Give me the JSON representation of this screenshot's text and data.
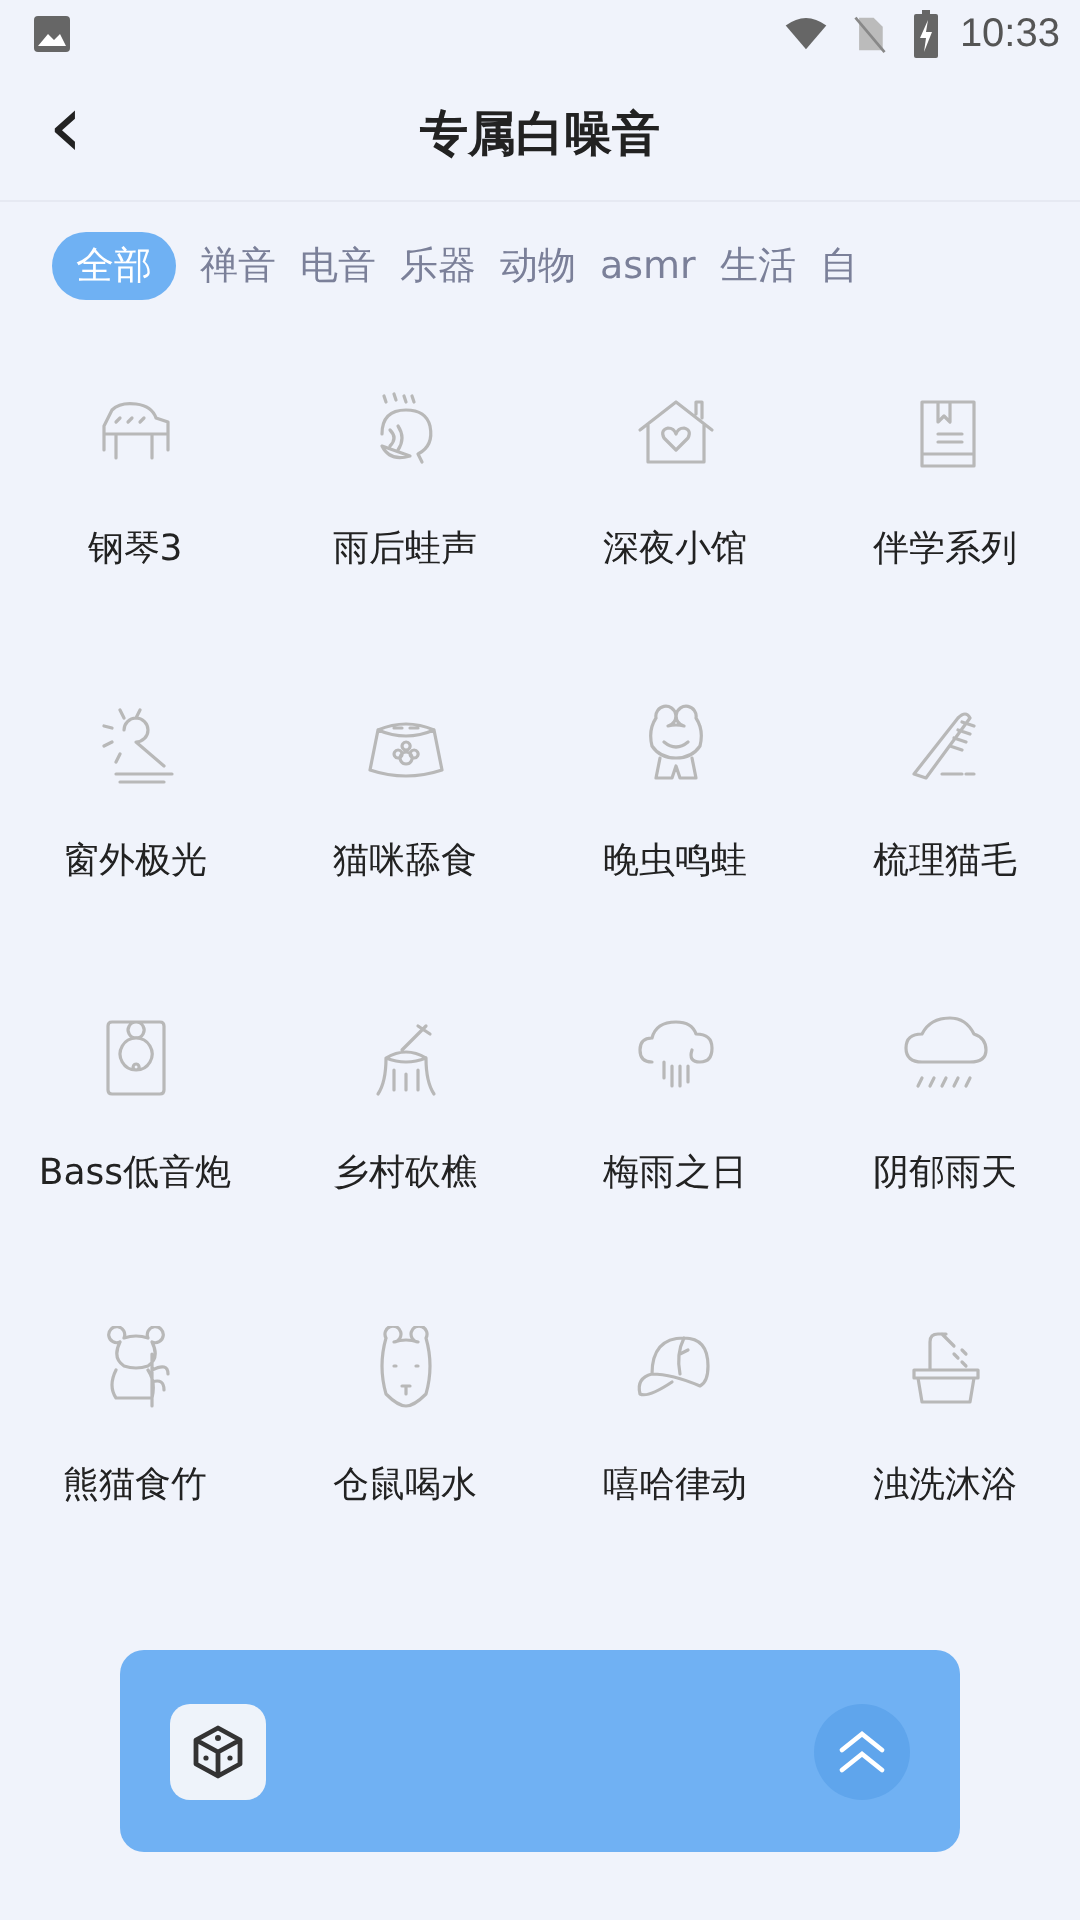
{
  "status_bar": {
    "time": "10:33"
  },
  "header": {
    "back": "‹",
    "title": "专属白噪音"
  },
  "tabs": [
    {
      "label": "全部",
      "selected": true
    },
    {
      "label": "禅音",
      "selected": false
    },
    {
      "label": "电音",
      "selected": false
    },
    {
      "label": "乐器",
      "selected": false
    },
    {
      "label": "动物",
      "selected": false
    },
    {
      "label": "asmr",
      "selected": false
    },
    {
      "label": "生活",
      "selected": false
    },
    {
      "label": "自",
      "selected": false
    }
  ],
  "sounds": [
    {
      "name": "钢琴3"
    },
    {
      "name": "雨后蛙声"
    },
    {
      "name": "深夜小馆"
    },
    {
      "name": "伴学系列"
    },
    {
      "name": "窗外极光"
    },
    {
      "name": "猫咪舔食"
    },
    {
      "name": "晚虫鸣蛙"
    },
    {
      "name": "梳理猫毛"
    },
    {
      "name": "Bass低音炮"
    },
    {
      "name": "乡村砍樵"
    },
    {
      "name": "梅雨之日"
    },
    {
      "name": "阴郁雨天"
    },
    {
      "name": "熊猫食竹"
    },
    {
      "name": "仓鼠喝水"
    },
    {
      "name": "嘻哈律动"
    },
    {
      "name": "浊洗沐浴"
    }
  ]
}
